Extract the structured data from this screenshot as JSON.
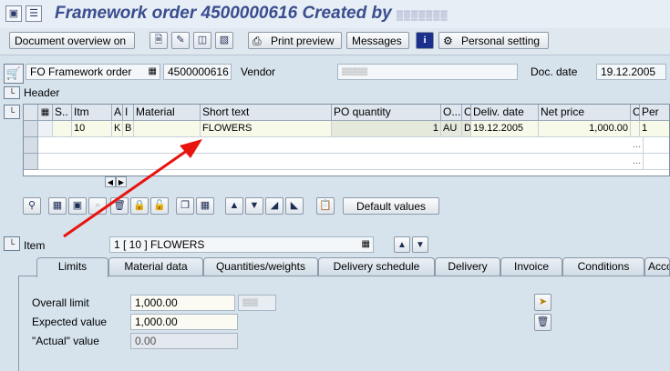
{
  "window": {
    "title": "Framework order 4500000616 Created by",
    "title_user_masked": "▒▒▒▒▒▒▒"
  },
  "toolbar": {
    "document_overview_label": "Document overview on",
    "print_preview_label": "Print preview",
    "messages_label": "Messages",
    "personal_setting_label": "Personal setting"
  },
  "header": {
    "order_type": "FO Framework order",
    "order_number": "4500000616",
    "vendor_label": "Vendor",
    "vendor_value": "▒▒▒▒▒",
    "doc_date_label": "Doc. date",
    "doc_date_value": "19.12.2005",
    "header_label": "Header"
  },
  "items_table": {
    "columns": [
      "S..",
      "Itm",
      "A",
      "I",
      "Material",
      "Short text",
      "PO quantity",
      "O...",
      "C",
      "Deliv. date",
      "Net price",
      "C",
      "Per"
    ],
    "rows": [
      {
        "itm": "10",
        "a": "K",
        "i": "B",
        "material": "",
        "short_text": "FLOWERS",
        "po_quantity": "1",
        "oun": "AU",
        "c": "D",
        "deliv_date": "19.12.2005",
        "net_price": "1,000.00",
        "c2": "",
        "per": "1"
      }
    ],
    "ellipsis": "..."
  },
  "grid_toolbar": {
    "default_values_label": "Default values"
  },
  "item": {
    "label": "Item",
    "selected_value": "1 [ 10 ] FLOWERS"
  },
  "tabs": [
    "Limits",
    "Material data",
    "Quantities/weights",
    "Delivery schedule",
    "Delivery",
    "Invoice",
    "Conditions",
    "Accou"
  ],
  "limits": {
    "overall_limit_label": "Overall limit",
    "overall_limit_value": "1,000.00",
    "overall_limit_unit": "▒▒▒",
    "expected_value_label": "Expected value",
    "expected_value_value": "1,000.00",
    "actual_value_label": "\"Actual\" value",
    "actual_value_value": "0.00"
  },
  "colors": {
    "title": "#3a4d8f",
    "background": "#d6e2ec",
    "annotation_arrow": "#e8140e"
  }
}
